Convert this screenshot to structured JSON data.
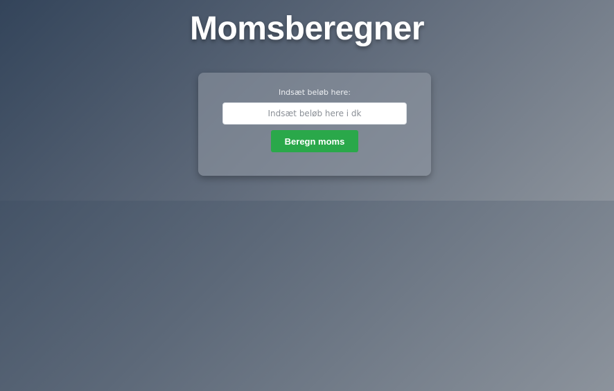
{
  "page": {
    "title": "Momsberegner"
  },
  "form": {
    "label": "Indsæt beløb here:",
    "input_placeholder": "Indsæt beløb here i dk",
    "input_value": "",
    "button_label": "Beregn moms"
  },
  "colors": {
    "button": "#2aa84a",
    "background_dark": "#33445a",
    "background_light": "#8c939c"
  }
}
